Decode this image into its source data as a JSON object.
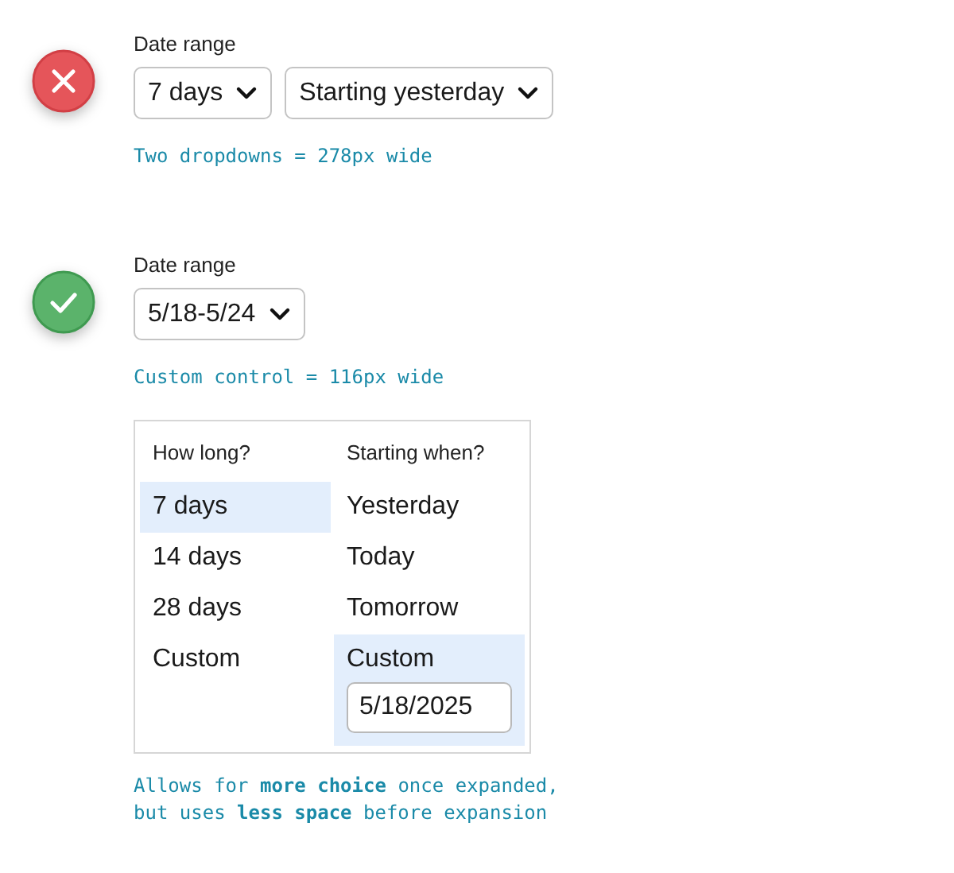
{
  "examples": [
    {
      "kind": "cross",
      "label": "Date range",
      "dropdowns": [
        "7 days",
        "Starting yesterday"
      ],
      "caption": "Two dropdowns = 278px wide"
    },
    {
      "kind": "check",
      "label": "Date range",
      "dropdowns": [
        "5/18-5/24"
      ],
      "caption": "Custom control = 116px wide"
    }
  ],
  "panel": {
    "columns": [
      {
        "heading": "How long?",
        "options": [
          {
            "label": "7 days",
            "selected": true
          },
          {
            "label": "14 days",
            "selected": false
          },
          {
            "label": "28 days",
            "selected": false
          },
          {
            "label": "Custom",
            "selected": false
          }
        ]
      },
      {
        "heading": "Starting when?",
        "options": [
          {
            "label": "Yesterday",
            "selected": false
          },
          {
            "label": "Today",
            "selected": false
          },
          {
            "label": "Tomorrow",
            "selected": false
          },
          {
            "label": "Custom",
            "selected": true,
            "value": "5/18/2025"
          }
        ]
      }
    ]
  },
  "note": "Allows for **more choice** once expanded,\nbut uses **less space** before expansion"
}
